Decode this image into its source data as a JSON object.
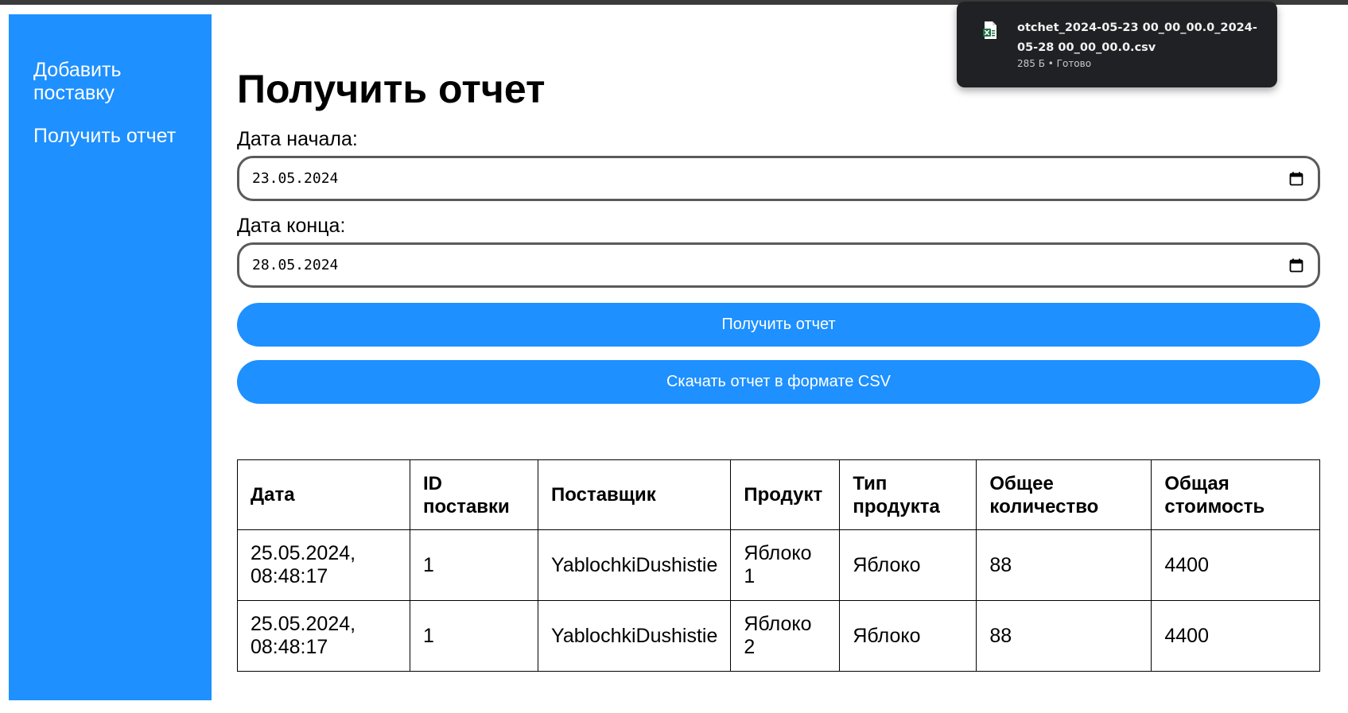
{
  "sidebar": {
    "items": [
      {
        "label": "Добавить поставку"
      },
      {
        "label": "Получить отчет"
      }
    ]
  },
  "main": {
    "title": "Получить отчет",
    "start_label": "Дата начала:",
    "start_value": "23.05.2024",
    "end_label": "Дата конца:",
    "end_value": "28.05.2024",
    "get_report_button": "Получить отчет",
    "download_csv_button": "Скачать отчет в формате CSV"
  },
  "table": {
    "headers": [
      "Дата",
      "ID поставки",
      "Поставщик",
      "Продукт",
      "Тип продукта",
      "Общее количество",
      "Общая стоимость"
    ],
    "rows": [
      [
        "25.05.2024, 08:48:17",
        "1",
        "YablochkiDushistie",
        "Яблоко 1",
        "Яблоко",
        "88",
        "4400"
      ],
      [
        "25.05.2024, 08:48:17",
        "1",
        "YablochkiDushistie",
        "Яблоко 2",
        "Яблоко",
        "88",
        "4400"
      ]
    ]
  },
  "download_popup": {
    "file_name": "otchet_2024-05-23 00_00_00.0_2024-05-28 00_00_00.0.csv",
    "status": "285 Б • Готово",
    "icon": "excel-file-icon"
  },
  "colors": {
    "accent": "#1e90ff",
    "popup_bg": "#202124"
  }
}
